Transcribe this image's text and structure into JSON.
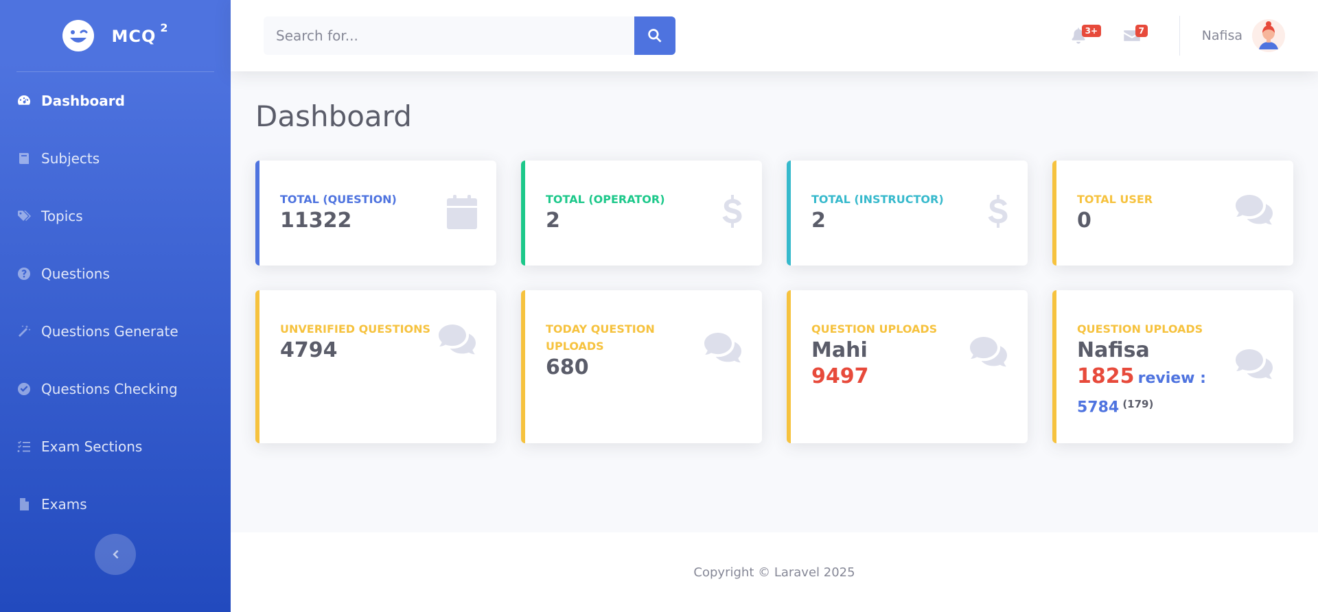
{
  "brand": {
    "name": "MCQ",
    "sup": "2"
  },
  "sidebar": {
    "items": [
      {
        "label": "Dashboard",
        "icon": "tachometer-icon",
        "active": true
      },
      {
        "label": "Subjects",
        "icon": "book-icon"
      },
      {
        "label": "Topics",
        "icon": "tags-icon"
      },
      {
        "label": "Questions",
        "icon": "question-circle-icon"
      },
      {
        "label": "Questions Generate",
        "icon": "magic-icon"
      },
      {
        "label": "Questions Checking",
        "icon": "check-circle-icon"
      },
      {
        "label": "Exam Sections",
        "icon": "tasks-icon"
      },
      {
        "label": "Exams",
        "icon": "file-icon"
      }
    ]
  },
  "search": {
    "placeholder": "Search for...",
    "value": ""
  },
  "topbar": {
    "alerts_badge": "3+",
    "messages_badge": "7",
    "user_name": "Nafisa"
  },
  "page": {
    "title": "Dashboard"
  },
  "cards_row1": [
    {
      "label": "TOTAL (QUESTION)",
      "value": "11322",
      "variant": "primary",
      "icon": "calendar-icon"
    },
    {
      "label": "TOTAL (OPERATOR)",
      "value": "2",
      "variant": "success",
      "icon": "dollar-icon"
    },
    {
      "label": "TOTAL (INSTRUCTOR)",
      "value": "2",
      "variant": "info",
      "icon": "dollar-icon"
    },
    {
      "label": "TOTAL USER",
      "value": "0",
      "variant": "warning",
      "icon": "comments-icon"
    }
  ],
  "cards_row2": [
    {
      "label": "UNVERIFIED QUESTIONS",
      "value": "4794"
    },
    {
      "label": "TODAY QUESTION UPLOADS",
      "value": "680"
    },
    {
      "label": "QUESTION UPLOADS",
      "name": "Mahi",
      "count": "9497"
    },
    {
      "label": "QUESTION UPLOADS",
      "name": "Nafisa",
      "count": "1825",
      "review_label": "review :",
      "review_value": "5784",
      "review_sub": "(179)"
    }
  ],
  "footer": {
    "text": "Copyright © Laravel 2025"
  },
  "colors": {
    "primary": "#4e73df",
    "success": "#1cc88a",
    "info": "#36b9cc",
    "warning": "#f6c23e",
    "danger": "#e74a3b"
  }
}
